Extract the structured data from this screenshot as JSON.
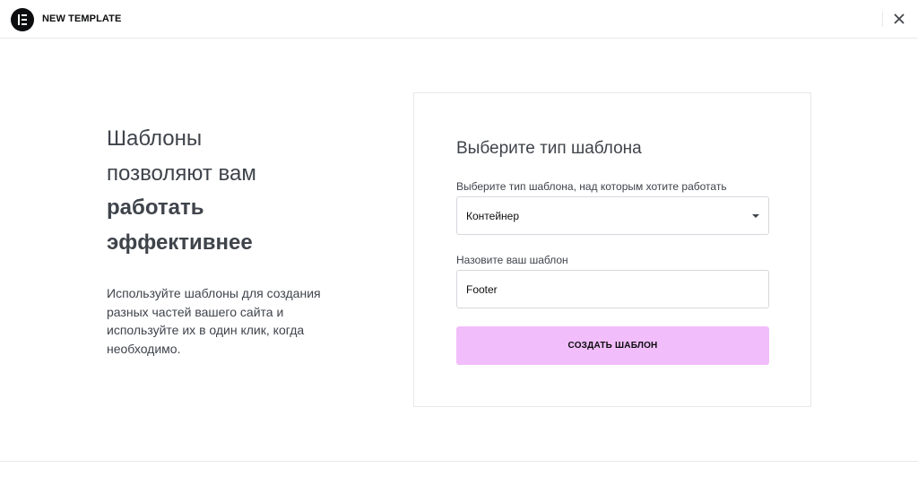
{
  "header": {
    "title": "NEW TEMPLATE",
    "logo_icon": "elementor-logo-icon",
    "close_icon": "close-icon"
  },
  "intro": {
    "heading_light_line1": "Шаблоны",
    "heading_light_line2": "позволяют вам",
    "heading_bold_line1": "работать",
    "heading_bold_line2": "эффективнее",
    "description": "Используйте шаблоны для создания разных частей вашего сайта и используйте их в один клик, когда необходимо."
  },
  "form": {
    "title": "Выберите тип шаблона",
    "type_label": "Выберите тип шаблона, над которым хотите работать",
    "type_value": "Контейнер",
    "name_label": "Назовите ваш шаблон",
    "name_value": "Footer",
    "submit_label": "СОЗДАТЬ ШАБЛОН"
  },
  "colors": {
    "accent_button": "#f2bdfb",
    "text_dark": "#0c0d0e",
    "text_body": "#3f444b",
    "border": "#e6e8ea"
  }
}
